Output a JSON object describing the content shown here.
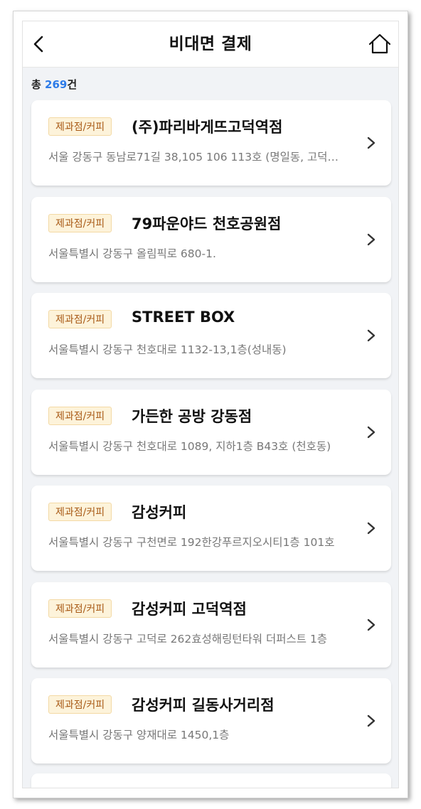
{
  "header": {
    "title": "비대면 결제",
    "back_icon": "back-arrow-icon",
    "home_icon": "home-icon"
  },
  "summary": {
    "prefix": "총 ",
    "count": "269",
    "suffix": "건"
  },
  "stores": [
    {
      "category": "제과점/커피",
      "name": "(주)파리바게뜨고덕역점",
      "address": "서울 강동구 동남로71길 38,105 106 113호 (명일동, 고덕역..."
    },
    {
      "category": "제과점/커피",
      "name": "79파운야드 천호공원점",
      "address": "서울특별시 강동구 올림픽로 680-1."
    },
    {
      "category": "제과점/커피",
      "name": "STREET BOX",
      "address": "서울특별시 강동구 천호대로 1132-13,1층(성내동)"
    },
    {
      "category": "제과점/커피",
      "name": "가든한 공방 강동점",
      "address": "서울특별시 강동구 천호대로 1089, 지하1층 B43호 (천호동)"
    },
    {
      "category": "제과점/커피",
      "name": "감성커피",
      "address": "서울특별시 강동구 구천면로 192한강푸르지오시티1층 101호"
    },
    {
      "category": "제과점/커피",
      "name": "감성커피 고덕역점",
      "address": "서울특별시 강동구 고덕로 262효성해링턴타워 더퍼스트 1층"
    },
    {
      "category": "제과점/커피",
      "name": "감성커피 길동사거리점",
      "address": "서울특별시 강동구 양재대로 1450,1층"
    }
  ],
  "colors": {
    "accent": "#2d7be8",
    "badge_bg": "#fdf3da",
    "badge_text": "#a85a16",
    "background": "#f1f3f6"
  }
}
